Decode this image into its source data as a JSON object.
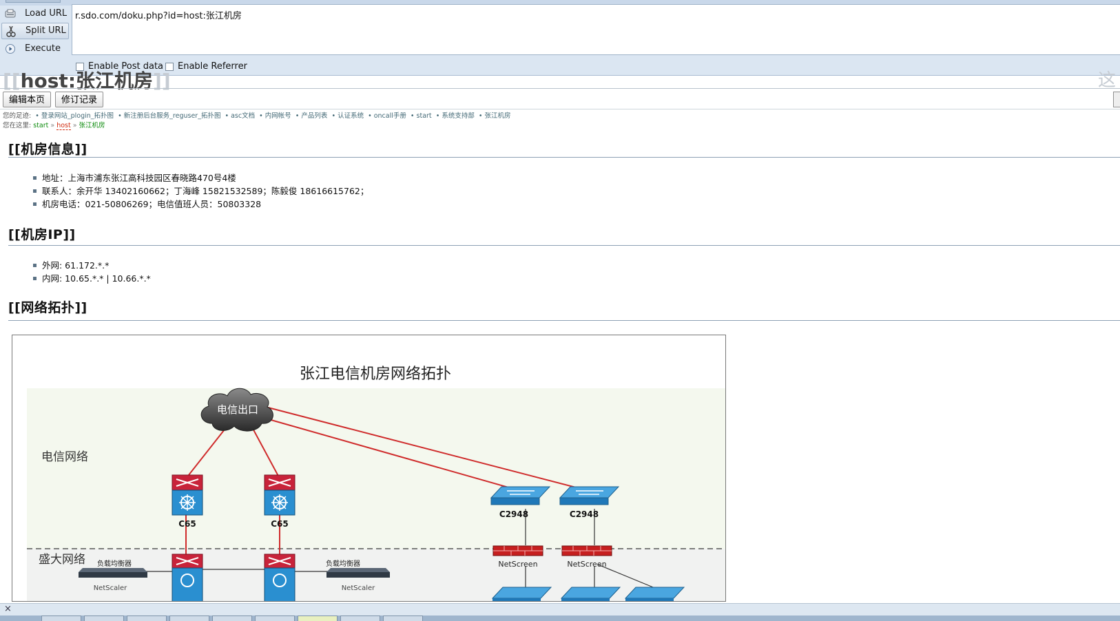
{
  "hackbar": {
    "load_url": "Load URL",
    "split_url": "Split URL",
    "execute": "Execute",
    "url_value": "r.sdo.com/doku.php?id=host:张江机房",
    "enable_post": "Enable Post data",
    "enable_referrer": "Enable Referrer"
  },
  "page": {
    "ghost_title_open": "[[",
    "ghost_title_text": "host:张江机房",
    "ghost_title_close": "]]",
    "ghost_right": "这",
    "edit_button": "编辑本页",
    "revisions_button": "修订记录",
    "trace_label": "您的足迹:",
    "trace_items": [
      "登录网站_plogin_拓扑图",
      "新注册后台服务_reguser_拓扑图",
      "asc文档",
      "内网帐号",
      "产品列表",
      "认证系统",
      "oncall手册",
      "start",
      "系统支持部",
      "张江机房"
    ],
    "you_are_here_label": "您在这里:",
    "crumbs": [
      "start",
      "host",
      "张江机房"
    ]
  },
  "sections": [
    {
      "title": "[[机房信息]]",
      "items": [
        "地址：上海市浦东张江高科技园区春晓路470号4楼",
        "联系人：余开华 13402160662；丁海峰 15821532589；陈毅俊 18616615762；",
        "机房电话：021-50806269；电信值班人员：50803328"
      ]
    },
    {
      "title": "[[机房IP]]",
      "items": [
        "外网: 61.172.*.*",
        "内网: 10.65.*.* | 10.66.*.*"
      ]
    },
    {
      "title": "[[网络拓扑]]",
      "items": []
    }
  ],
  "diagram": {
    "title": "张江电信机房网络拓扑",
    "zone_telecom": "电信网络",
    "zone_shanda": "盛大网络",
    "cloud_label": "电信出口",
    "core_switches": [
      "C65",
      "C65"
    ],
    "access_switches": [
      "C2948",
      "C2948"
    ],
    "firewalls": [
      "NetScreen",
      "NetScreen"
    ],
    "load_balancer_label": "负载均衡器",
    "load_balancer_model": "NetScaler",
    "colors": {
      "link": "#cf2b2b",
      "switch_red": "#c8233a",
      "switch_blue": "#2a8fd0",
      "zone_top": "#f4f8ee",
      "zone_bottom": "#f1f2f1"
    }
  },
  "status": {
    "close": "×"
  }
}
